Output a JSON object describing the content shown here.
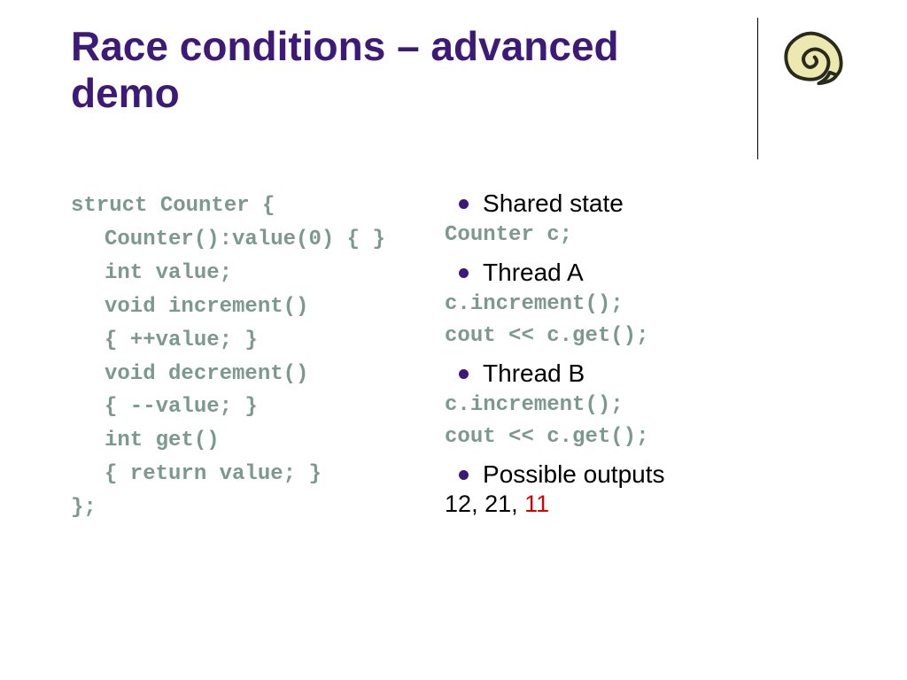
{
  "title": "Race conditions – advanced demo",
  "code_left": {
    "l1": "struct Counter {",
    "l2": "Counter():value(0) { }",
    "l3": "int value;",
    "l4a": "void increment()",
    "l4b": "{ ++value; }",
    "l5a": "void decrement()",
    "l5b": "{ --value; }",
    "l6a": "int get()",
    "l6b": "{ return value; }",
    "l7": "};"
  },
  "right": {
    "b1": "Shared state",
    "c1": "Counter c;",
    "b2": "Thread A",
    "c2a": "c.increment();",
    "c2b": "cout << c.get();",
    "b3": "Thread B",
    "c3a": "c.increment();",
    "c3b": "cout << c.get();",
    "b4": "Possible outputs",
    "out_prefix": "12, 21,",
    "out_red": "11"
  }
}
